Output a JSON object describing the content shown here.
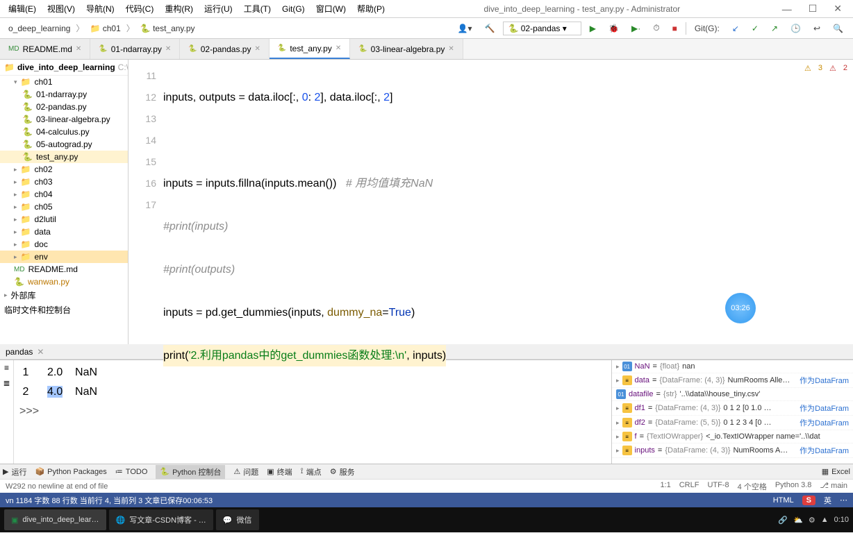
{
  "window": {
    "title": "dive_into_deep_learning - test_any.py - Administrator"
  },
  "menu": {
    "edit": "编辑(E)",
    "view": "视图(V)",
    "navigate": "导航(N)",
    "code": "代码(C)",
    "refactor": "重构(R)",
    "run": "运行(U)",
    "tools": "工具(T)",
    "git": "Git(G)",
    "window": "窗口(W)",
    "help": "帮助(P)"
  },
  "breadcrumb": {
    "root": "o_deep_learning",
    "dir": "ch01",
    "file": "test_any.py"
  },
  "config": {
    "selected": "02-pandas",
    "git": "Git(G):"
  },
  "tabs": {
    "readme": "README.md",
    "ndarray": "01-ndarray.py",
    "pandas": "02-pandas.py",
    "testany": "test_any.py",
    "linalg": "03-linear-algebra.py"
  },
  "sidebar": {
    "project": {
      "name": "dive_into_deep_learning",
      "loc": "C:\\U"
    },
    "items": {
      "ch01": "ch01",
      "nd": "01-ndarray.py",
      "pd": "02-pandas.py",
      "la": "03-linear-algebra.py",
      "calc": "04-calculus.py",
      "auto": "05-autograd.py",
      "test": "test_any.py",
      "ch02": "ch02",
      "ch03": "ch03",
      "ch04": "ch04",
      "ch05": "ch05",
      "d2l": "d2lutil",
      "data": "data",
      "doc": "doc",
      "env": "env",
      "readme": "README.md",
      "wanwan": "wanwan.py",
      "ext": "外部库",
      "scratch": "临时文件和控制台"
    }
  },
  "editor": {
    "warns": "3",
    "errs": "2",
    "lines": {
      "l11": "11",
      "l12": "12",
      "l13": "13",
      "l14": "14",
      "l15": "15",
      "l16": "16",
      "l17": "17"
    },
    "code": {
      "l11a": "inputs, outputs = data.iloc[:, ",
      "l11n1": "0",
      "l11b": ": ",
      "l11n2": "2",
      "l11c": "], data.iloc[:, ",
      "l11n3": "2",
      "l11d": "]",
      "l13a": "inputs = inputs.fillna(inputs.mean())   ",
      "l13c": "# 用均值填充NaN",
      "l14": "#print(inputs)",
      "l15": "#print(outputs)",
      "l16a": "inputs = pd.get_dummies(inputs, ",
      "l16k": "dummy_na",
      "l16b": "=",
      "l16v": "True",
      "l16c": ")",
      "l17a": "print(",
      "l17s": "'2.利用pandas中的get_dummies函数处理:\\n'",
      "l17b": ", inputs)"
    },
    "timer": "03:26"
  },
  "console": {
    "tab": "pandas",
    "rows": {
      "r1a": " 1      2.0    NaN",
      "r2a": " 2      ",
      "r2sel": "4.0",
      "r2b": "    NaN",
      "prompt": ">>> "
    }
  },
  "vars": {
    "nan": {
      "name": "NaN",
      "type": "{float}",
      "val": "nan"
    },
    "data": {
      "name": "data",
      "type": "{DataFrame: (4, 3)}",
      "val": "NumRooms Alle…"
    },
    "datafile": {
      "name": "datafile",
      "type": "{str}",
      "val": "'..\\\\data\\\\house_tiny.csv'"
    },
    "df1": {
      "name": "df1",
      "type": "{DataFrame: (4, 3)}",
      "val": "0   1   2 [0  1.0 …"
    },
    "df2": {
      "name": "df2",
      "type": "{DataFrame: (5, 5)}",
      "val": "0  1   2   3   4 [0 …"
    },
    "f": {
      "name": "f",
      "type": "{TextIOWrapper}",
      "val": "<_io.TextIOWrapper name='..\\\\dat"
    },
    "inputs": {
      "name": "inputs",
      "type": "{DataFrame: (4, 3)}",
      "val": "NumRooms  A…"
    },
    "link": "作为DataFram"
  },
  "bottombar": {
    "run": "运行",
    "pkg": "Python Packages",
    "todo": "TODO",
    "console": "Python 控制台",
    "issues": "问题",
    "terminal": "终端",
    "endpoints": "端点",
    "services": "服务",
    "excel": "Excel"
  },
  "status": {
    "warn": "W292 no newline at end of file",
    "pos": "1:1",
    "crlf": "CRLF",
    "enc": "UTF-8",
    "indent": "4 个空格",
    "py": "Python 3.8",
    "branch": "main"
  },
  "status2": {
    "left": "vn  1184 字数  88 行数  当前行 4, 当前列 3  文章已保存00:06:53",
    "html": "HTML",
    "ime": "S",
    "lang": "英"
  },
  "taskbar": {
    "ide": "dive_into_deep_lear…",
    "browser": "写文章-CSDN博客 - …",
    "wechat": "微信",
    "time": "0:10"
  }
}
